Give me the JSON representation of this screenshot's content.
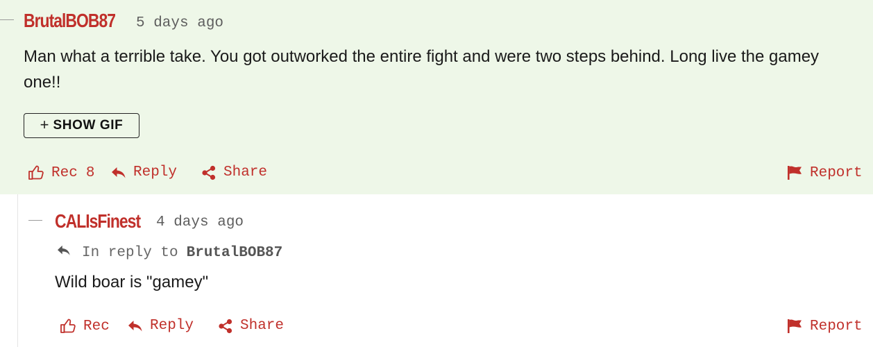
{
  "colors": {
    "accent": "#c0302b",
    "highlight_bg": "#eef7e8",
    "text": "#1a1a1a",
    "muted": "#5e5e5e"
  },
  "comments": [
    {
      "username": "BrutalBOB87",
      "timestamp": "5 days ago",
      "body": "Man what a terrible take. You got outworked the entire fight and were two steps behind. Long live the gamey one!!",
      "gif_button": {
        "icon": "plus-icon",
        "label": "SHOW GIF"
      },
      "actions": {
        "rec_label": "Rec",
        "rec_count": "8",
        "reply_label": "Reply",
        "share_label": "Share",
        "report_label": "Report"
      }
    },
    {
      "username": "CALIsFinest",
      "timestamp": "4 days ago",
      "in_reply_to": {
        "prefix": "In reply to",
        "user": "BrutalBOB87"
      },
      "body": "Wild boar is \"gamey\"",
      "actions": {
        "rec_label": "Rec",
        "reply_label": "Reply",
        "share_label": "Share",
        "report_label": "Report"
      }
    }
  ],
  "icons": {
    "rec": "thumbs-up-icon",
    "reply": "reply-arrow-icon",
    "share": "share-icon",
    "report": "flag-icon"
  }
}
